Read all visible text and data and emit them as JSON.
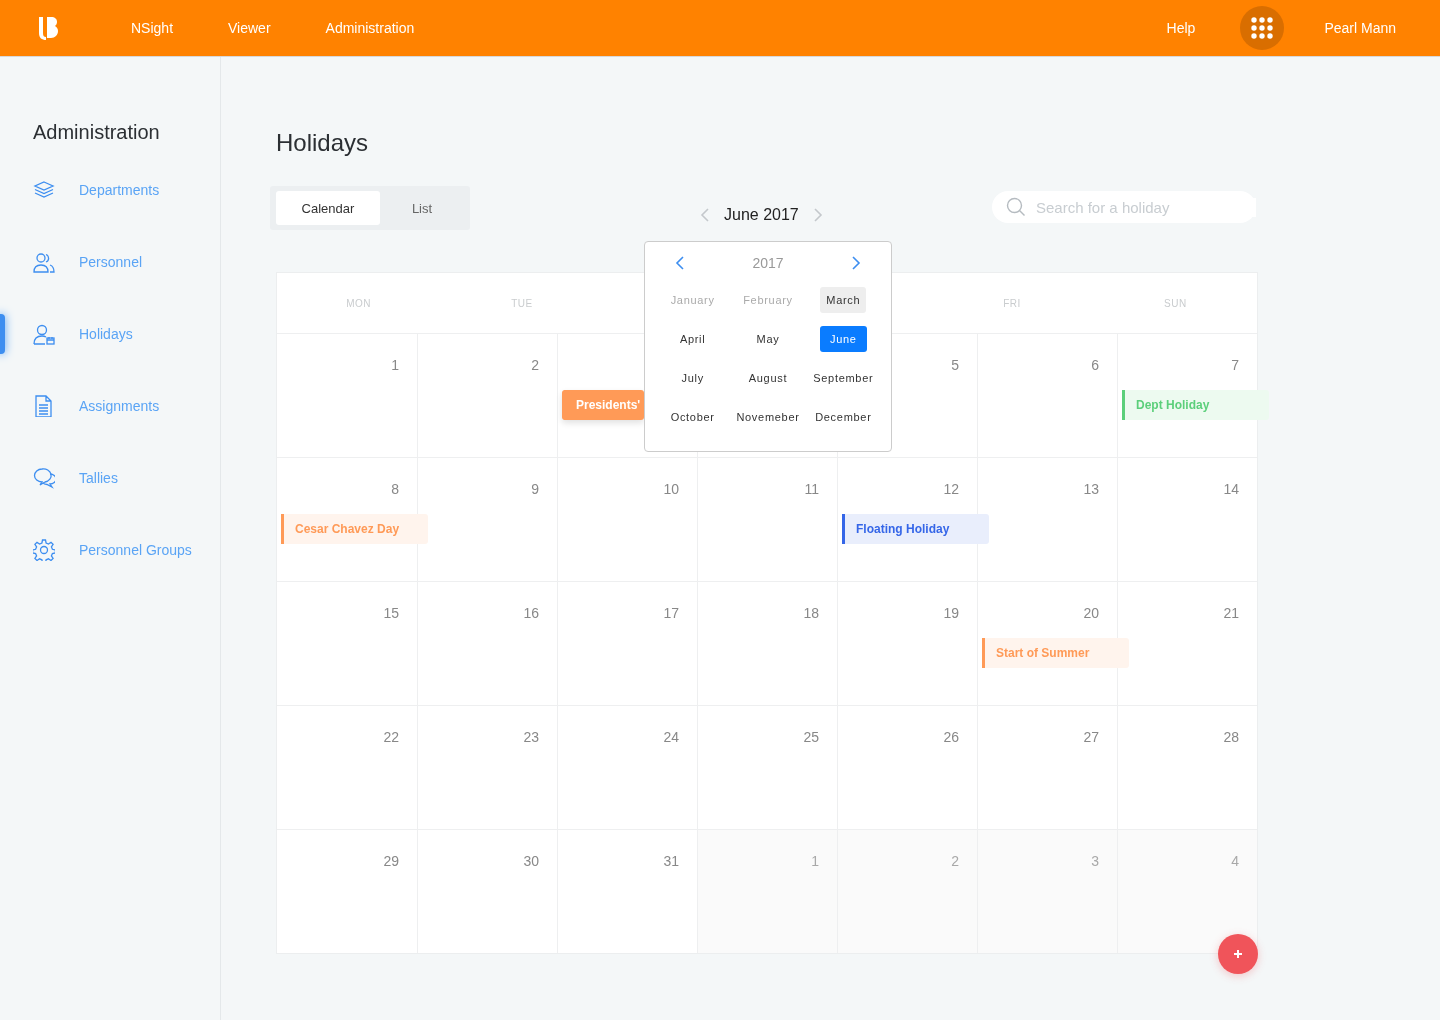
{
  "topbar": {
    "nav": [
      {
        "label": "NSight"
      },
      {
        "label": "Viewer"
      },
      {
        "label": "Administration"
      }
    ],
    "help": "Help",
    "user": "Pearl Mann"
  },
  "sidebar": {
    "title": "Administration",
    "items": [
      {
        "label": "Departments",
        "selected": false
      },
      {
        "label": "Personnel",
        "selected": false
      },
      {
        "label": "Holidays",
        "selected": true
      },
      {
        "label": "Assignments",
        "selected": false
      },
      {
        "label": "Tallies",
        "selected": false
      },
      {
        "label": "Personnel Groups",
        "selected": false
      }
    ]
  },
  "page": {
    "title": "Holidays",
    "view_tabs": [
      {
        "label": "Calendar",
        "selected": true
      },
      {
        "label": "List",
        "selected": false
      }
    ],
    "month_nav": {
      "label": "June 2017"
    },
    "search": {
      "placeholder": "Search for a holiday"
    }
  },
  "calendar": {
    "weekday_headers": [
      "MON",
      "TUE",
      "FRI",
      "SUN"
    ],
    "weeks": [
      [
        {
          "day": "1"
        },
        {
          "day": "2"
        },
        {
          "kind": "covered",
          "events": [
            {
              "label": "Presidents'",
              "color": "#ff9a57",
              "selected": true
            }
          ]
        },
        {
          "kind": "covered"
        },
        {
          "day": "5"
        },
        {
          "day": "6"
        },
        {
          "day": "7",
          "events": [
            {
              "label": "Dept Holiday",
              "color": "#5ccf7b",
              "selected": false
            }
          ]
        }
      ],
      [
        {
          "day": "8",
          "events": [
            {
              "label": "Cesar Chavez Day",
              "color": "#ff9a57",
              "selected": false
            }
          ]
        },
        {
          "day": "9"
        },
        {
          "day": "10"
        },
        {
          "day": "11"
        },
        {
          "day": "12",
          "events": [
            {
              "label": "Floating Holiday",
              "color": "#3566e8",
              "selected": false
            }
          ]
        },
        {
          "day": "13"
        },
        {
          "day": "14"
        }
      ],
      [
        {
          "day": "15"
        },
        {
          "day": "16"
        },
        {
          "day": "17"
        },
        {
          "day": "18"
        },
        {
          "day": "19"
        },
        {
          "day": "20",
          "events": [
            {
              "label": "Start of Summer",
              "color": "#ff9a57",
              "selected": false
            }
          ]
        },
        {
          "day": "21"
        }
      ],
      [
        {
          "day": "22"
        },
        {
          "day": "23"
        },
        {
          "day": "24"
        },
        {
          "day": "25"
        },
        {
          "day": "26"
        },
        {
          "day": "27"
        },
        {
          "day": "28"
        }
      ],
      [
        {
          "day": "29"
        },
        {
          "day": "30"
        },
        {
          "day": "31"
        },
        {
          "day": "1",
          "kind": "outside"
        },
        {
          "day": "2",
          "kind": "outside"
        },
        {
          "day": "3",
          "kind": "outside"
        },
        {
          "day": "4",
          "kind": "outside"
        }
      ]
    ]
  },
  "month_picker": {
    "year": "2017",
    "months": [
      {
        "label": "January",
        "selected": false,
        "disabled": true,
        "highlighted": false
      },
      {
        "label": "February",
        "selected": false,
        "disabled": true,
        "highlighted": false
      },
      {
        "label": "March",
        "selected": false,
        "disabled": false,
        "highlighted": true
      },
      {
        "label": "April",
        "selected": false,
        "disabled": false,
        "highlighted": false
      },
      {
        "label": "May",
        "selected": false,
        "disabled": false,
        "highlighted": false
      },
      {
        "label": "June",
        "selected": true,
        "disabled": false,
        "highlighted": false
      },
      {
        "label": "July",
        "selected": false,
        "disabled": false,
        "highlighted": false
      },
      {
        "label": "August",
        "selected": false,
        "disabled": false,
        "highlighted": false
      },
      {
        "label": "September",
        "selected": false,
        "disabled": false,
        "highlighted": false
      },
      {
        "label": "October",
        "selected": false,
        "disabled": false,
        "highlighted": false
      },
      {
        "label": "Novemeber",
        "selected": false,
        "disabled": false,
        "highlighted": false
      },
      {
        "label": "December",
        "selected": false,
        "disabled": false,
        "highlighted": false
      }
    ]
  }
}
